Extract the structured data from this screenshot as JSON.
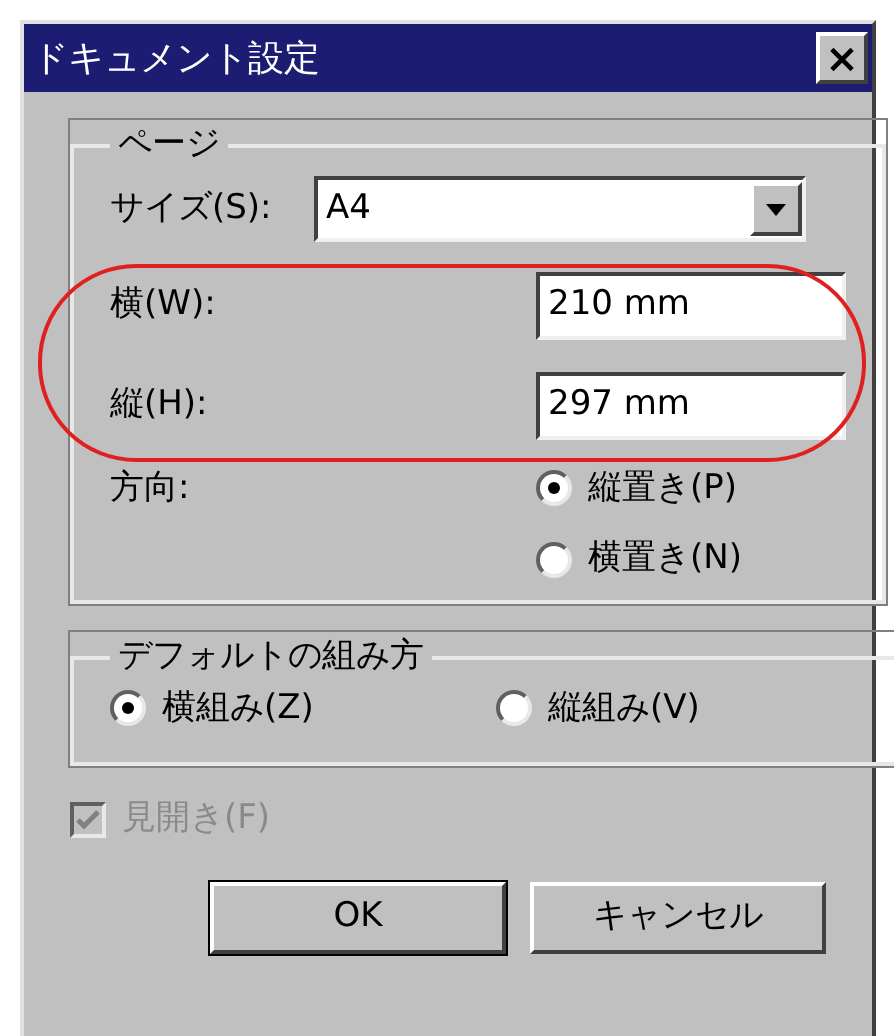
{
  "window": {
    "title": "ドキュメント設定",
    "close": "×"
  },
  "page_group": {
    "title": "ページ",
    "size": {
      "label": "サイズ(S):",
      "value": "A4"
    },
    "width": {
      "label": "横(W):",
      "value": "210 mm"
    },
    "height": {
      "label": "縦(H):",
      "value": "297 mm"
    },
    "orientation": {
      "label": "方向:",
      "options": [
        {
          "label": "縦置き(P)",
          "selected": true
        },
        {
          "label": "横置き(N)",
          "selected": false
        }
      ]
    }
  },
  "layout_group": {
    "title": "デフォルトの組み方",
    "options": [
      {
        "label": "横組み(Z)",
        "selected": true
      },
      {
        "label": "縦組み(V)",
        "selected": false
      }
    ]
  },
  "spread": {
    "label": "見開き(F)",
    "checked": true,
    "disabled": true
  },
  "buttons": [
    {
      "label": "OK",
      "default": true
    },
    {
      "label": "キャンセル",
      "default": false
    }
  ]
}
